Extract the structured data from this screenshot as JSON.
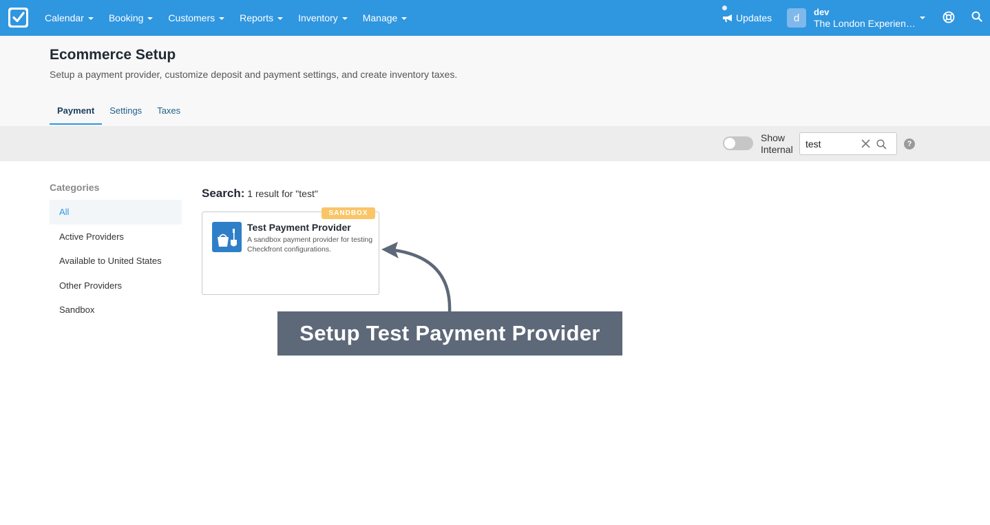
{
  "nav": {
    "items": [
      {
        "label": "Calendar"
      },
      {
        "label": "Booking"
      },
      {
        "label": "Customers"
      },
      {
        "label": "Reports"
      },
      {
        "label": "Inventory"
      },
      {
        "label": "Manage"
      }
    ],
    "updates_label": "Updates",
    "account": {
      "avatar_initial": "d",
      "user": "dev",
      "company": "The London Experienc..."
    }
  },
  "header": {
    "title": "Ecommerce Setup",
    "subtitle": "Setup a payment provider, customize deposit and payment settings, and create inventory taxes.",
    "tabs": [
      {
        "label": "Payment",
        "active": true
      },
      {
        "label": "Settings",
        "active": false
      },
      {
        "label": "Taxes",
        "active": false
      }
    ]
  },
  "filter": {
    "toggle_label": "Show Internal",
    "toggle_on": false,
    "search_value": "test",
    "help_glyph": "?"
  },
  "sidebar": {
    "title": "Categories",
    "items": [
      {
        "label": "All",
        "active": true
      },
      {
        "label": "Active Providers"
      },
      {
        "label": "Available to United States"
      },
      {
        "label": "Other Providers"
      },
      {
        "label": "Sandbox"
      }
    ]
  },
  "results": {
    "heading_label": "Search:",
    "heading_text": "1 result for \"test\"",
    "cards": [
      {
        "badge": "SANDBOX",
        "name": "Test Payment Provider",
        "description": "A sandbox payment provider for testing Checkfront configurations.",
        "icon": "bucket-and-spade-icon"
      }
    ]
  },
  "annotation": {
    "text": "Setup Test Payment Provider"
  },
  "colors": {
    "nav_bg": "#2f96e0",
    "callout_bg": "#5d6878",
    "badge_bg": "#f9c567",
    "provider_icon_bg": "#2f7fc8"
  }
}
